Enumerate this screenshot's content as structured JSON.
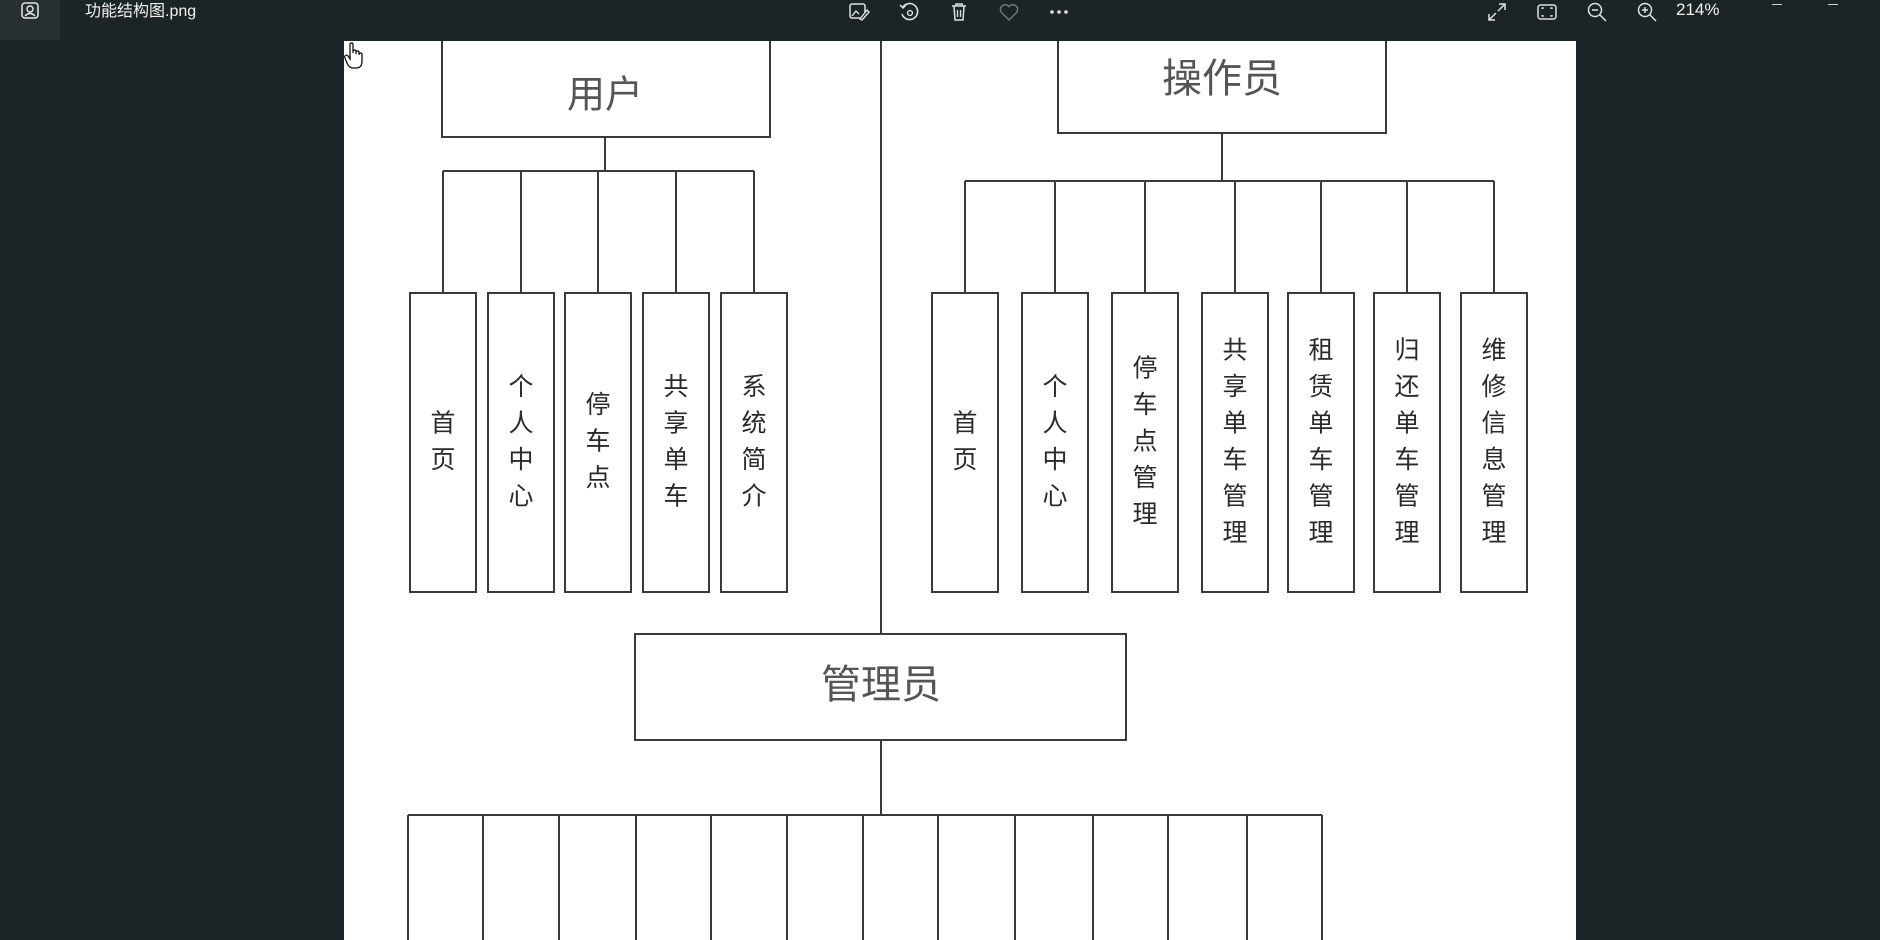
{
  "titlebar": {
    "file_name": "功能结构图.png",
    "zoom_level": "214%",
    "icons": [
      "photos-app-icon",
      "edit-image-icon",
      "rotate-icon",
      "delete-icon",
      "favorite-icon",
      "more-icon",
      "fullscreen-icon",
      "fit-to-window-icon",
      "zoom-out-icon",
      "zoom-in-icon"
    ]
  },
  "diagram": {
    "user": {
      "label": "用户",
      "children": [
        "首页",
        "个人中心",
        "停车点",
        "共享单车",
        "系统简介"
      ]
    },
    "operator": {
      "label": "操作员",
      "children": [
        "首页",
        "个人中心",
        "停车点管理",
        "共享单车管理",
        "租赁单车管理",
        "归还单车管理",
        "维修信息管理"
      ]
    },
    "admin": {
      "label": "管理员",
      "children_count_visible": 12
    }
  },
  "colors": {
    "window_bg": "#1b2527",
    "canvas_bg": "#ffffff",
    "line": "#3a3a3a"
  }
}
